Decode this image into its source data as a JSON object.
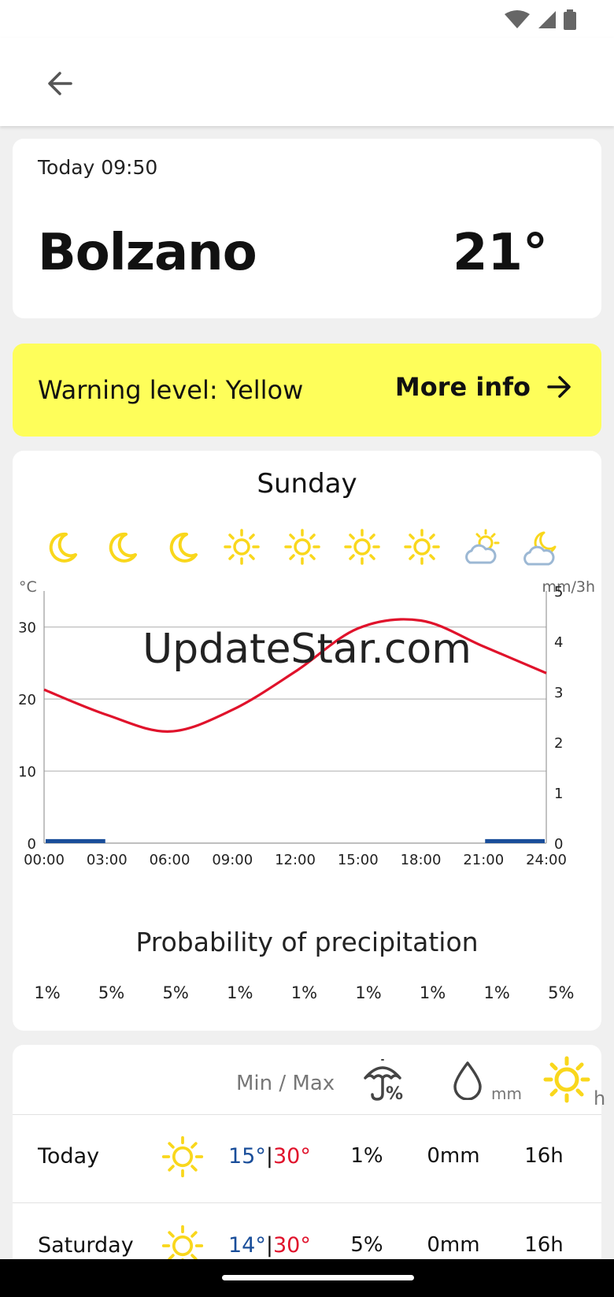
{
  "location": {
    "updated": "Today 09:50",
    "city": "Bolzano",
    "temperature": "21°"
  },
  "warning": {
    "text": "Warning level: Yellow",
    "link_label": "More info"
  },
  "forecast": {
    "day_title": "Sunday",
    "hour_icons": [
      "moon-icon",
      "moon-icon",
      "moon-icon",
      "sun-icon",
      "sun-icon",
      "sun-icon",
      "sun-icon",
      "sun-cloud-icon",
      "moon-cloud-icon"
    ],
    "watermark": "UpdateStar.com",
    "precip_title": "Probability of precipitation",
    "precip_probabilities": [
      "1%",
      "5%",
      "5%",
      "1%",
      "1%",
      "1%",
      "1%",
      "1%",
      "5%"
    ]
  },
  "chart_data": {
    "type": "line",
    "x_ticks": [
      "00:00",
      "03:00",
      "06:00",
      "09:00",
      "12:00",
      "15:00",
      "18:00",
      "21:00",
      "24:00"
    ],
    "left_axis_unit": "°C",
    "right_axis_unit": "mm/3h",
    "left_ylim": [
      0,
      35
    ],
    "left_ticks": [
      "0",
      "10",
      "20",
      "30"
    ],
    "right_ylim": [
      0,
      5
    ],
    "right_ticks": [
      "0",
      "1",
      "2",
      "3",
      "4",
      "5"
    ],
    "grid": true,
    "series": [
      {
        "kind": "temperature-line",
        "color": "#e0122b",
        "x_hours": [
          0,
          3,
          6,
          9,
          12,
          15,
          18,
          21,
          24
        ],
        "values": [
          21.3,
          17.8,
          15.5,
          18.5,
          23.8,
          29.8,
          30.9,
          27.3,
          23.6
        ]
      },
      {
        "kind": "precipitation-bars",
        "color": "#1a4e9a",
        "x_hours": [
          0,
          3,
          6,
          9,
          12,
          15,
          18,
          21
        ],
        "values": [
          0.08,
          0,
          0,
          0,
          0,
          0,
          0,
          0.08
        ]
      }
    ]
  },
  "table": {
    "minmax_label": "Min / Max",
    "mm_unit": "mm",
    "sun_unit": "h",
    "rows": [
      {
        "day": "Today",
        "icon": "sun-icon",
        "min": "15°",
        "max": "30°",
        "precip": "1%",
        "rain": "0mm",
        "sun": "16h"
      },
      {
        "day": "Saturday",
        "icon": "sun-icon",
        "min": "14°",
        "max": "30°",
        "precip": "5%",
        "rain": "0mm",
        "sun": "16h"
      }
    ]
  },
  "colors": {
    "warning_yellow": "#fefe5a",
    "temp_red": "#e0122b",
    "rain_blue": "#1a4e9a",
    "icon_yellow": "#f9d71c"
  }
}
